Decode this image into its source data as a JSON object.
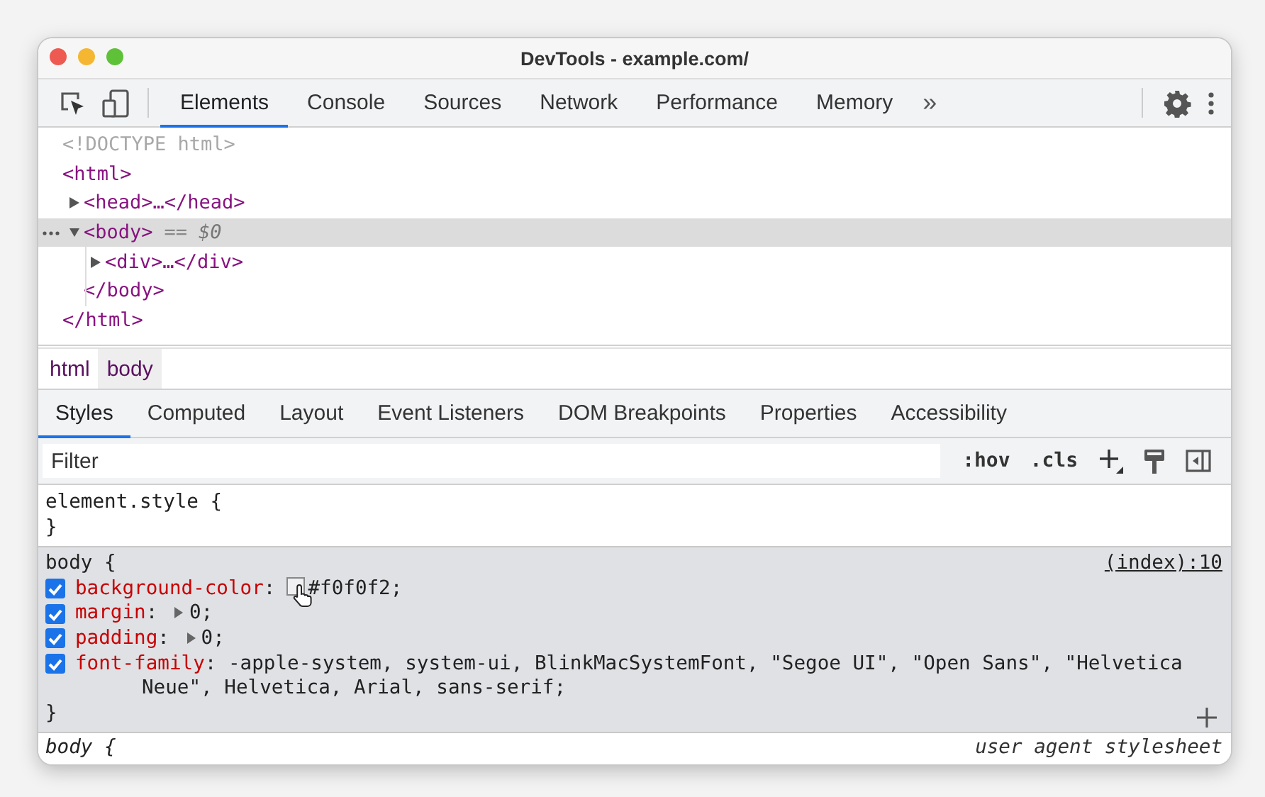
{
  "window": {
    "title": "DevTools - example.com/"
  },
  "toolbar": {
    "tabs": [
      {
        "label": "Elements",
        "selected": true
      },
      {
        "label": "Console",
        "selected": false
      },
      {
        "label": "Sources",
        "selected": false
      },
      {
        "label": "Network",
        "selected": false
      },
      {
        "label": "Performance",
        "selected": false
      },
      {
        "label": "Memory",
        "selected": false
      }
    ],
    "overflow": "»"
  },
  "dom_tree": [
    {
      "text": "<!DOCTYPE html>",
      "kind": "doctype",
      "selected": false
    },
    {
      "text": "<html>",
      "kind": "element",
      "selected": false,
      "closing": "</html>",
      "children": [
        {
          "text": "<head>…</head>",
          "kind": "element",
          "expanded": false,
          "selected": false
        },
        {
          "text": "<body>",
          "kind": "element",
          "expanded": true,
          "selected": true,
          "note": "==",
          "var": "$0",
          "closing": "</body>",
          "children": [
            {
              "text": "<div>…</div>",
              "kind": "element",
              "expanded": false,
              "selected": false
            }
          ]
        }
      ]
    }
  ],
  "breadcrumbs": [
    {
      "label": "html",
      "selected": false
    },
    {
      "label": "body",
      "selected": true
    }
  ],
  "panel_tabs": [
    {
      "label": "Styles",
      "selected": true
    },
    {
      "label": "Computed",
      "selected": false
    },
    {
      "label": "Layout",
      "selected": false
    },
    {
      "label": "Event Listeners",
      "selected": false
    },
    {
      "label": "DOM Breakpoints",
      "selected": false
    },
    {
      "label": "Properties",
      "selected": false
    },
    {
      "label": "Accessibility",
      "selected": false
    }
  ],
  "filter": {
    "placeholder": "Filter",
    "buttons": [
      ":hov",
      ".cls"
    ]
  },
  "rules": [
    {
      "kind": "inline",
      "selector": "element.style {",
      "close": "}"
    },
    {
      "kind": "author",
      "selector": "body {",
      "source": "(index):10",
      "close": "}",
      "declarations": [
        {
          "name": "background-color",
          "separator": ":",
          "value": "#f0f0f2;",
          "kind": "color",
          "checked": true
        },
        {
          "name": "margin",
          "separator": ":",
          "value": "0;",
          "kind": "shorthand",
          "checked": true
        },
        {
          "name": "padding",
          "separator": ":",
          "value": "0;",
          "kind": "shorthand",
          "checked": true
        },
        {
          "name": "font-family",
          "separator": ":",
          "value": "-apple-system, system-ui, BlinkMacSystemFont, \"Segoe UI\", \"Open Sans\", \"Helvetica Neue\", Helvetica, Arial, sans-serif;",
          "kind": "plain",
          "checked": true
        }
      ]
    },
    {
      "kind": "user-agent",
      "selector": "body {",
      "source": "user agent stylesheet"
    }
  ]
}
